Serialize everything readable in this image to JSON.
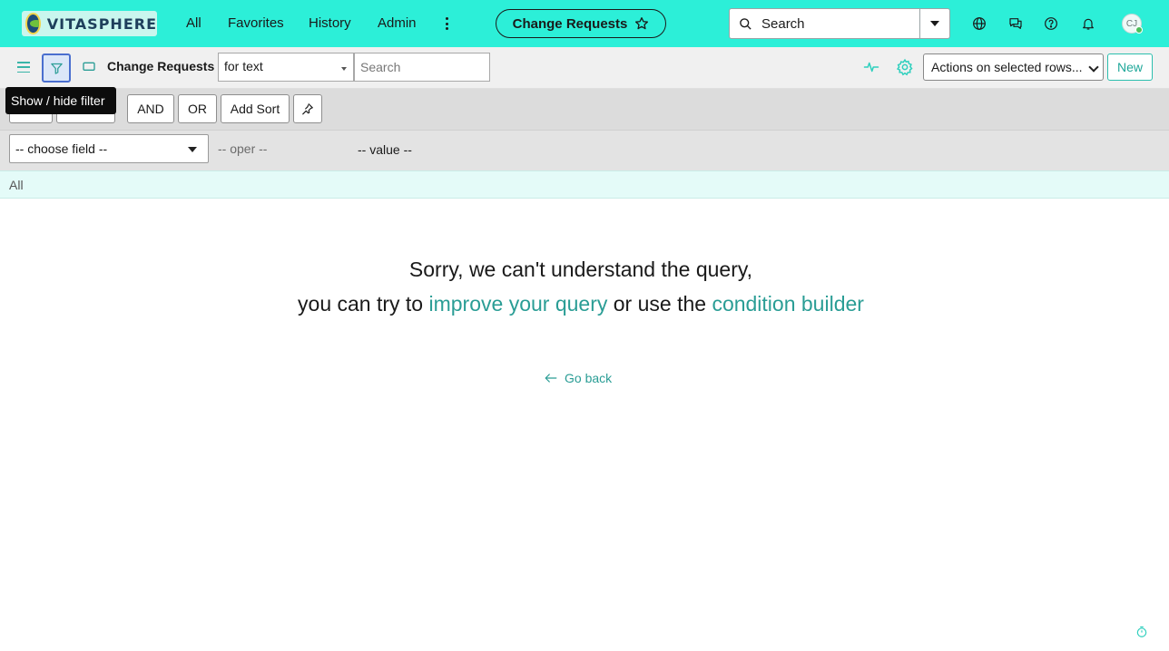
{
  "header": {
    "logo_text": "VITASPHERE",
    "nav": [
      "All",
      "Favorites",
      "History",
      "Admin"
    ],
    "context_button": "Change Requests",
    "search_placeholder": "Search",
    "avatar_initials": "CJ"
  },
  "list": {
    "title": "Change Requests",
    "search_field_option": "for text",
    "search_placeholder": "Search",
    "actions_placeholder": "Actions on selected rows...",
    "new_label": "New"
  },
  "filter": {
    "tooltip": "Show / hide filter",
    "and_label": "AND",
    "or_label": "OR",
    "add_sort_label": "Add Sort",
    "field_placeholder": "-- choose field --",
    "oper_placeholder": "-- oper --",
    "value_placeholder": "-- value --"
  },
  "breadcrumb": "All",
  "message": {
    "line1": "Sorry, we can't understand the query,",
    "line2_prefix": "you can try to",
    "link1": "improve your query",
    "line2_middle": "or use the",
    "link2": "condition builder",
    "go_back": "Go back"
  },
  "colors": {
    "brand_banner": "#2cefd8",
    "link": "#2a9d95",
    "breadcrumb_bg": "#e4fbf8"
  },
  "icons": {
    "search": "search-icon",
    "globe": "globe-icon",
    "chat": "chat-icon",
    "help": "help-icon",
    "bell": "bell-icon",
    "filter": "filter-icon",
    "gear": "gear-icon",
    "pin": "pin-icon",
    "star": "star-icon"
  }
}
